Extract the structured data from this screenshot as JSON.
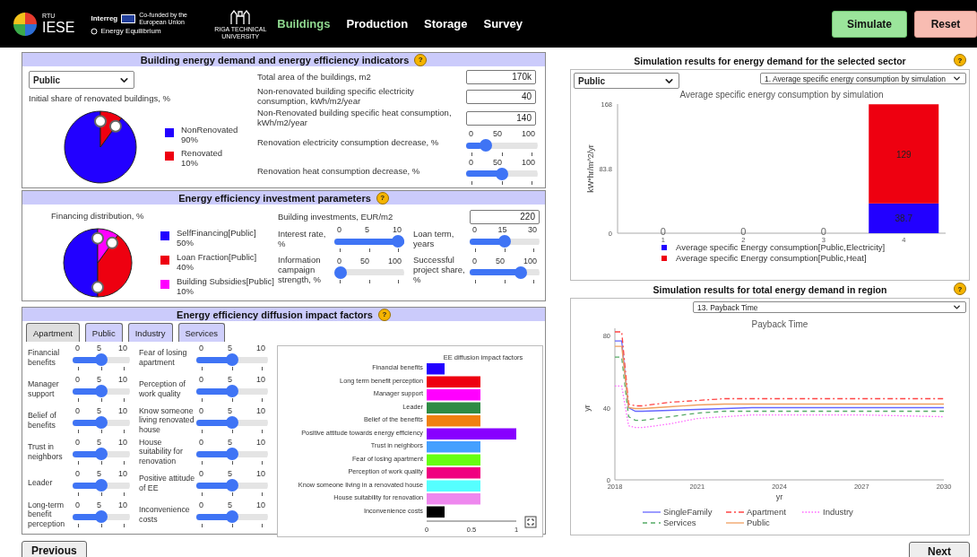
{
  "header": {
    "branding": {
      "org_small": "RTU",
      "org": "IESE",
      "program": "Interreg",
      "funding": "Co-funded by the European Union",
      "project": "Energy Equilibrium",
      "university": "RIGA TECHNICAL UNIVERSITY"
    },
    "nav": [
      {
        "label": "Buildings",
        "selected": true
      },
      {
        "label": "Production",
        "selected": false
      },
      {
        "label": "Storage",
        "selected": false
      },
      {
        "label": "Survey",
        "selected": false
      }
    ],
    "actions": [
      {
        "label": "Simulate",
        "kind": "primary"
      },
      {
        "label": "Reset",
        "kind": "danger"
      }
    ]
  },
  "building_panel": {
    "title": "Building energy demand and energy efficiency indicators",
    "help": "?",
    "sector": "Public",
    "share_label": "Initial share of renovated buildings, %",
    "legend": [
      {
        "value": "90%",
        "color": "#2200ff"
      },
      {
        "value": "10%",
        "color": "#ee0010"
      }
    ],
    "chart_data": {
      "type": "pie",
      "categories": [
        "NonRenovated",
        "Renovated"
      ],
      "values": [
        90,
        10
      ]
    },
    "fields": [
      {
        "label": "Total area of the buildings, m2",
        "value": "170k"
      },
      {
        "label": "Non-renovated building specific electricity consumption, kWh/m2/year",
        "value": "40"
      },
      {
        "label": "Non-Renovated building specific heat consumption, kWh/m2/year",
        "value": "140"
      }
    ],
    "sliders": [
      {
        "label": "Renovation electricity consumption decrease, %",
        "ticks": [
          "0",
          "50",
          "100"
        ],
        "level": 0.22
      },
      {
        "label": "Renovation heat consumption decrease, %",
        "ticks": [
          "0",
          "50",
          "100"
        ],
        "level": 0.5
      }
    ]
  },
  "investment_panel": {
    "title": "Energy efficiency investment parameters",
    "help": "?",
    "pie_label": "Financing distribution, %",
    "legend": [
      {
        "value": "50%",
        "color": "#2200ff"
      },
      {
        "value": "40%",
        "color": "#ee0010"
      },
      {
        "value": "10%",
        "color": "#ff00ff"
      }
    ],
    "chart_data": {
      "type": "pie",
      "categories": [
        "SelfFinancing[Public]",
        "Loan Fraction[Public]",
        "Building Subsidies[Public]"
      ],
      "values": [
        50,
        40,
        10
      ]
    },
    "field": {
      "label": "Building investments, EUR/m2",
      "value": "220"
    },
    "sliders": [
      {
        "label": "Interest rate, %",
        "ticks": [
          "0",
          "5",
          "10"
        ],
        "level": 1
      },
      {
        "label": "Loan term, years",
        "ticks": [
          "0",
          "15",
          "30"
        ],
        "level": 0.5
      },
      {
        "label": "Information campaign strength, %",
        "ticks": [
          "0",
          "50",
          "100"
        ],
        "level": 0
      },
      {
        "label": "Successful project share, %",
        "ticks": [
          "0",
          "50",
          "100"
        ],
        "level": 0.78
      }
    ]
  },
  "diffusion_panel": {
    "title": "Energy efficiency diffusion impact factors",
    "help": "?",
    "tabs": [
      {
        "label": "Apartment",
        "selected": true
      },
      {
        "label": "Public",
        "selected": false
      },
      {
        "label": "Industry",
        "selected": false
      },
      {
        "label": "Services",
        "selected": false
      }
    ],
    "factor_columns": [
      {
        "items": [
          {
            "label": "Financial benefits",
            "ticks": [
              "0",
              "5",
              "10"
            ],
            "level": 0.5
          },
          {
            "label": "Manager support",
            "ticks": [
              "0",
              "5",
              "10"
            ],
            "level": 0.5
          },
          {
            "label": "Belief of benefits",
            "ticks": [
              "0",
              "5",
              "10"
            ],
            "level": 0.5
          },
          {
            "label": "Trust in neighbors",
            "ticks": [
              "0",
              "5",
              "10"
            ],
            "level": 0.5
          },
          {
            "label": "Leader",
            "ticks": [
              "0",
              "5",
              "10"
            ],
            "level": 0.5
          },
          {
            "label": "Long-term benefit perception",
            "ticks": [
              "0",
              "5",
              "10"
            ],
            "level": 0.5
          }
        ]
      },
      {
        "items": [
          {
            "label": "Fear of losing apartment",
            "ticks": [
              "0",
              "5",
              "10"
            ],
            "level": 0.5
          },
          {
            "label": "Perception of work quality",
            "ticks": [
              "0",
              "5",
              "10"
            ],
            "level": 0.5
          },
          {
            "label": "Know someone living renovated house",
            "ticks": [
              "0",
              "5",
              "10"
            ],
            "level": 0.5
          },
          {
            "label": "House suitability for renovation",
            "ticks": [
              "0",
              "5",
              "10"
            ],
            "level": 0.5
          },
          {
            "label": "Positive attitude of EE",
            "ticks": [
              "0",
              "5",
              "10"
            ],
            "level": 0.5
          },
          {
            "label": "Inconvenience costs",
            "ticks": [
              "0",
              "5",
              "10"
            ],
            "level": 0.5
          }
        ]
      }
    ],
    "chart_data": {
      "type": "bar",
      "orientation": "horizontal",
      "title": "EE diffusion impact factors",
      "stacked": true,
      "xlim": [
        0,
        1
      ],
      "xticks": [
        0,
        0.5,
        1
      ],
      "categories": [
        "Financial benefits",
        "Long term benefit perception",
        "Manager support",
        "Leader",
        "Belief of the benefits",
        "Positive attitude towards energy efficiency",
        "Trust in neighbors",
        "Fear of losing apartment",
        "Perception of work quality",
        "Know someone living in a renovated house",
        "House suitability for renovation",
        "Inconvenience costs"
      ],
      "series": [
        {
          "color": "#2200ff",
          "values": [
            0.2,
            null,
            null,
            null,
            null,
            null,
            null,
            null,
            null,
            null,
            null,
            null
          ]
        },
        {
          "color": "#ee0010",
          "values": [
            null,
            0.6,
            null,
            null,
            null,
            null,
            null,
            null,
            null,
            null,
            null,
            null
          ]
        },
        {
          "color": "#ff00ff",
          "values": [
            null,
            null,
            0.6,
            null,
            null,
            null,
            null,
            null,
            null,
            null,
            null,
            null
          ]
        },
        {
          "color": "#2e8b44",
          "values": [
            null,
            null,
            null,
            0.6,
            null,
            null,
            null,
            null,
            null,
            null,
            null,
            null
          ]
        },
        {
          "color": "#f08010",
          "values": [
            null,
            null,
            null,
            null,
            0.6,
            null,
            null,
            null,
            null,
            null,
            null,
            null
          ]
        },
        {
          "color": "#8800ff",
          "values": [
            null,
            null,
            null,
            null,
            null,
            1,
            null,
            null,
            null,
            null,
            null,
            null
          ]
        },
        {
          "color": "#44a0ff",
          "values": [
            null,
            null,
            null,
            null,
            null,
            null,
            0.6,
            null,
            null,
            null,
            null,
            null
          ]
        },
        {
          "color": "#66ff11",
          "values": [
            null,
            null,
            null,
            null,
            null,
            null,
            null,
            0.6,
            null,
            null,
            null,
            null
          ]
        },
        {
          "color": "#f00080",
          "values": [
            null,
            null,
            null,
            null,
            null,
            null,
            null,
            null,
            0.6,
            null,
            null,
            null
          ]
        },
        {
          "color": "#55ffff",
          "values": [
            null,
            null,
            null,
            null,
            null,
            null,
            null,
            null,
            null,
            0.6,
            null,
            null
          ]
        },
        {
          "color": "#ee88ee",
          "values": [
            null,
            null,
            null,
            null,
            null,
            null,
            null,
            null,
            null,
            null,
            0.6,
            null
          ]
        },
        {
          "color": "#000000",
          "values": [
            null,
            null,
            null,
            null,
            null,
            null,
            null,
            null,
            null,
            null,
            null,
            0.2
          ]
        }
      ]
    }
  },
  "sector_results": {
    "title": "Simulation results for energy demand for the selected sector",
    "help": "?",
    "sector": "Public",
    "indicator": "1. Average specific energy consumption by simulation",
    "chart_data": {
      "type": "bar",
      "title": "Average specific energy consumption by simulation",
      "ylabel": "kW*hr/m^2/yr",
      "categories": [
        "1",
        "2",
        "3",
        "4"
      ],
      "stacked": true,
      "ylim": [
        0,
        168
      ],
      "yticks": [
        0,
        83.8,
        168
      ],
      "legend": "bottom",
      "value_labels": [
        [
          "0",
          "0",
          "0",
          "38.7"
        ],
        [
          null,
          null,
          null,
          "129"
        ]
      ],
      "series": [
        {
          "name": "Average specific Energy consumption[Public,Electricity]",
          "color": "#2200ff",
          "values": [
            0,
            0,
            0,
            38.7
          ]
        },
        {
          "name": "Average specific Energy consumption[Public,Heat]",
          "color": "#ee0010",
          "values": [
            0,
            0,
            0,
            129
          ]
        }
      ]
    }
  },
  "region_results": {
    "title": "Simulation results for total energy demand in region",
    "help": "?",
    "indicator": "13. Payback Time",
    "chart_data": {
      "type": "line",
      "title": "Payback Time",
      "xlabel": "yr",
      "ylabel": "yr",
      "x": [
        2018,
        2018.25,
        2018.5,
        2018.75,
        2019,
        2020,
        2021,
        2022,
        2023,
        2024,
        2027,
        2030
      ],
      "xlim": [
        2018,
        2030
      ],
      "ylim": [
        0,
        84
      ],
      "xticks": [
        2018,
        2021,
        2024,
        2027,
        2030
      ],
      "yticks": [
        0,
        40,
        80
      ],
      "legend": "bottom",
      "series": [
        {
          "name": "SingleFamily",
          "color": "#6666ff",
          "line_style": "solid",
          "values": [
            77,
            77,
            40,
            38,
            38,
            38.5,
            39,
            39.5,
            40,
            40,
            40,
            40
          ]
        },
        {
          "name": "Apartment",
          "color": "#ff4444",
          "line_style": "dashdot",
          "values": [
            82,
            82,
            42,
            41,
            41,
            43,
            44,
            45,
            45,
            45,
            45,
            45
          ]
        },
        {
          "name": "Industry",
          "color": "#ff66ff",
          "line_style": "dotted",
          "values": [
            52,
            52,
            30,
            29,
            29,
            31,
            34,
            35,
            36,
            36,
            36,
            35
          ]
        },
        {
          "name": "Services",
          "color": "#55aa66",
          "line_style": "dashed",
          "values": [
            68,
            68,
            35,
            33,
            33,
            35,
            37,
            38,
            38,
            38,
            38,
            38
          ]
        },
        {
          "name": "Public",
          "color": "#f0a060",
          "line_style": "solid",
          "values": [
            74,
            74,
            40,
            39.5,
            39.5,
            40.5,
            41.5,
            42,
            42,
            42,
            42,
            42
          ]
        }
      ]
    }
  },
  "footer": {
    "previous": "Previous",
    "next": "Next"
  }
}
